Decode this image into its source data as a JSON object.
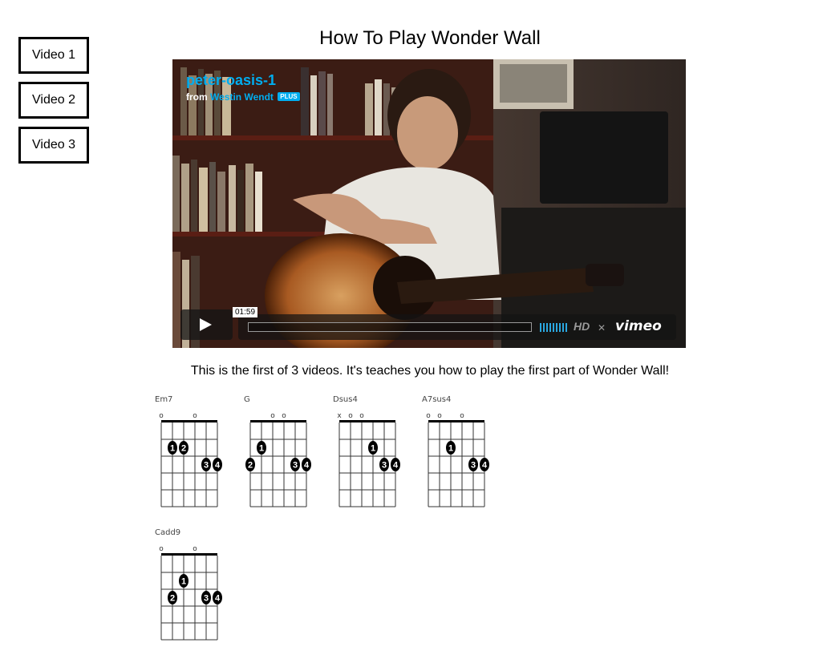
{
  "nav": {
    "video1": "Video 1",
    "video2": "Video 2",
    "video3": "Video 3"
  },
  "page": {
    "title": "How To Play Wonder Wall",
    "description": "This is the first of 3 videos. It's teaches you how to play the first part of Wonder Wall!"
  },
  "player": {
    "video_title": "peter-oasis-1",
    "from_label": "from",
    "author": "Westin Wendt",
    "badge": "PLUS",
    "time": "01:59",
    "hd_label": "HD",
    "logo": "vimeo",
    "accent_color": "#00adef"
  },
  "chords": [
    {
      "name": "Em7",
      "markers": [
        "o",
        "",
        "",
        "o",
        "",
        ""
      ],
      "dots": [
        {
          "string": 2,
          "fret": 2,
          "label": "1"
        },
        {
          "string": 3,
          "fret": 2,
          "label": "2"
        },
        {
          "string": 5,
          "fret": 3,
          "label": "3"
        },
        {
          "string": 6,
          "fret": 3,
          "label": "4"
        }
      ]
    },
    {
      "name": "G",
      "markers": [
        "",
        "",
        "o",
        "o",
        "",
        ""
      ],
      "dots": [
        {
          "string": 2,
          "fret": 2,
          "label": "1"
        },
        {
          "string": 1,
          "fret": 3,
          "label": "2"
        },
        {
          "string": 5,
          "fret": 3,
          "label": "3"
        },
        {
          "string": 6,
          "fret": 3,
          "label": "4"
        }
      ]
    },
    {
      "name": "Dsus4",
      "markers": [
        "x",
        "o",
        "o",
        "",
        "",
        ""
      ],
      "dots": [
        {
          "string": 4,
          "fret": 2,
          "label": "1"
        },
        {
          "string": 5,
          "fret": 3,
          "label": "3"
        },
        {
          "string": 6,
          "fret": 3,
          "label": "4"
        }
      ]
    },
    {
      "name": "A7sus4",
      "markers": [
        "o",
        "o",
        "",
        "o",
        "",
        ""
      ],
      "dots": [
        {
          "string": 3,
          "fret": 2,
          "label": "1"
        },
        {
          "string": 5,
          "fret": 3,
          "label": "3"
        },
        {
          "string": 6,
          "fret": 3,
          "label": "4"
        }
      ]
    },
    {
      "name": "Cadd9",
      "markers": [
        "o",
        "",
        "",
        "o",
        "",
        ""
      ],
      "dots": [
        {
          "string": 3,
          "fret": 2,
          "label": "1"
        },
        {
          "string": 2,
          "fret": 3,
          "label": "2"
        },
        {
          "string": 5,
          "fret": 3,
          "label": "3"
        },
        {
          "string": 6,
          "fret": 3,
          "label": "4"
        }
      ]
    }
  ]
}
